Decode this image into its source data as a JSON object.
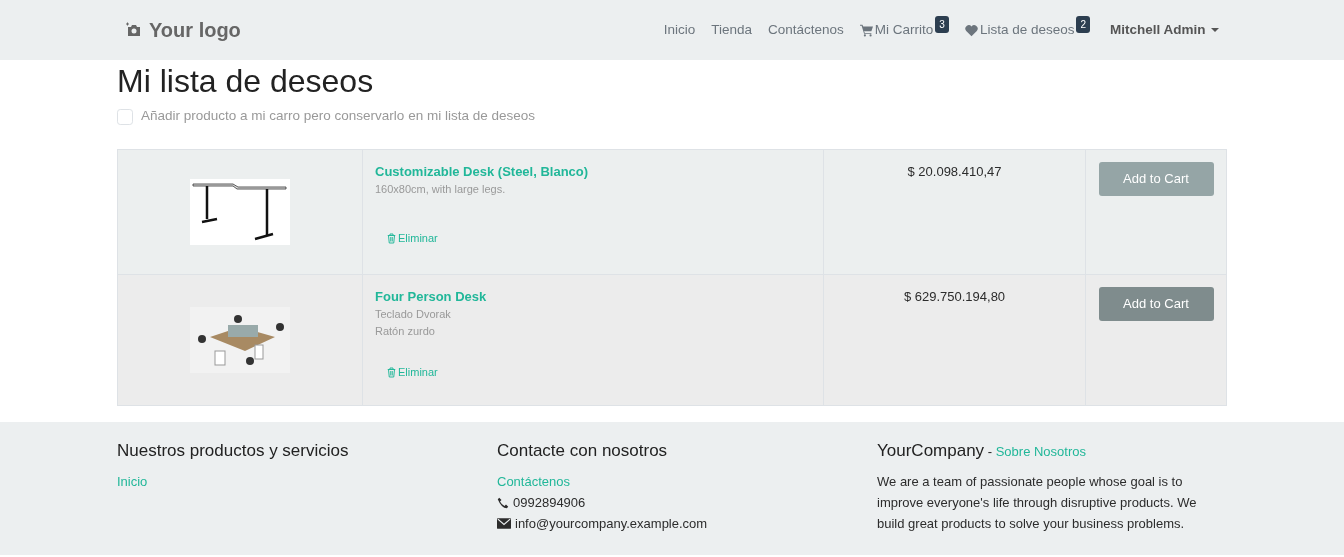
{
  "navbar": {
    "logo": "Your logo",
    "links": [
      {
        "label": "Inicio",
        "kind": "plain"
      },
      {
        "label": "Tienda",
        "kind": "plain"
      },
      {
        "label": "Contáctenos",
        "kind": "plain"
      },
      {
        "label": "Mi Carrito",
        "kind": "cart",
        "badge": "3"
      },
      {
        "label": "Lista de deseos",
        "kind": "wishlist",
        "badge": "2"
      }
    ],
    "user": "Mitchell Admin"
  },
  "page": {
    "title": "Mi lista de deseos",
    "keep_option": {
      "label": "Añadir producto a mi carro pero conservarlo en mi lista de deseos",
      "checked": false
    }
  },
  "wishlist": [
    {
      "name": "Customizable Desk (Steel, Blanco)",
      "details": [
        "160x80cm, with large legs."
      ],
      "remove": "Eliminar",
      "price": "$ 20.098.410,47",
      "button": "Add to Cart",
      "hovered": false,
      "kind": "desk"
    },
    {
      "name": "Four Person Desk",
      "details": [
        "Teclado Dvorak",
        "Ratón zurdo"
      ],
      "remove": "Eliminar",
      "price": "$ 629.750.194,80",
      "button": "Add to Cart",
      "hovered": true,
      "kind": "workstation"
    }
  ],
  "footer": {
    "products": {
      "title": "Nuestros productos y servicios",
      "links": [
        "Inicio"
      ]
    },
    "contact": {
      "title": "Contacte con nosotros",
      "link": "Contáctenos",
      "phone": "0992894906",
      "email": "info@yourcompany.example.com"
    },
    "about": {
      "company": "YourCompany",
      "separator": "-",
      "link": "Sobre Nosotros",
      "text": "We are a team of passionate people whose goal is to improve everyone's life through disruptive products. We build great products to solve your business problems."
    }
  }
}
